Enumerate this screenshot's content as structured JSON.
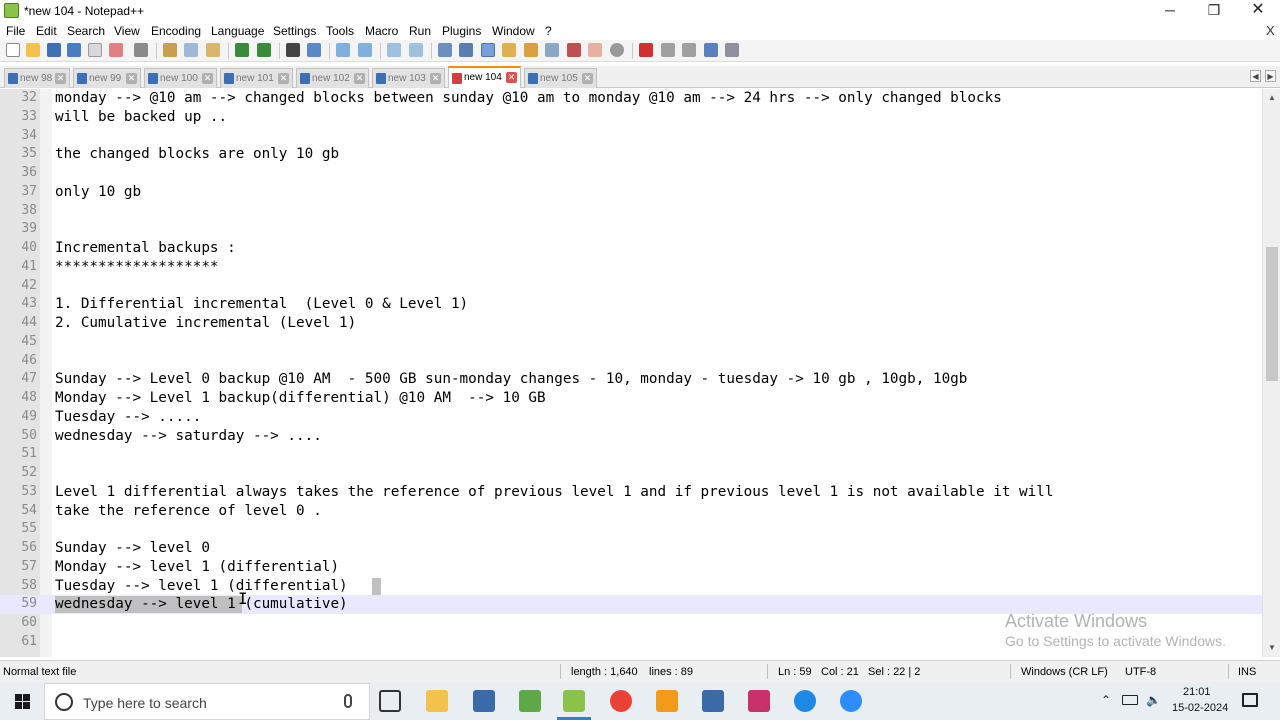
{
  "window": {
    "title": "*new 104 - Notepad++",
    "controls": {
      "minimize": "─",
      "maximize": "❐",
      "close": "✕"
    }
  },
  "menu": {
    "items": [
      "File",
      "Edit",
      "Search",
      "View",
      "Encoding",
      "Language",
      "Settings",
      "Tools",
      "Macro",
      "Run",
      "Plugins",
      "Window",
      "?"
    ],
    "close_glyph": "X"
  },
  "tabs": {
    "items": [
      "new 98",
      "new 99",
      "new 100",
      "new 101",
      "new 102",
      "new 103",
      "new 104",
      "new 105"
    ],
    "active": "new 104",
    "close_glyph": "✕",
    "scroll_left": "◀",
    "scroll_right": "▶"
  },
  "editor": {
    "lines": [
      {
        "n": "32",
        "text": "monday --> @10 am --> changed blocks between sunday @10 am to monday @10 am --> 24 hrs --> only changed blocks"
      },
      {
        "n": "33",
        "text": "will be backed up .."
      },
      {
        "n": "34",
        "text": ""
      },
      {
        "n": "35",
        "text": "the changed blocks are only 10 gb"
      },
      {
        "n": "36",
        "text": ""
      },
      {
        "n": "37",
        "text": "only 10 gb"
      },
      {
        "n": "38",
        "text": ""
      },
      {
        "n": "39",
        "text": ""
      },
      {
        "n": "40",
        "text": "Incremental backups :"
      },
      {
        "n": "41",
        "text": "*******************"
      },
      {
        "n": "42",
        "text": ""
      },
      {
        "n": "43",
        "text": "1. Differential incremental  (Level 0 & Level 1)"
      },
      {
        "n": "44",
        "text": "2. Cumulative incremental (Level 1)"
      },
      {
        "n": "45",
        "text": ""
      },
      {
        "n": "46",
        "text": ""
      },
      {
        "n": "47",
        "text": "Sunday --> Level 0 backup @10 AM  - 500 GB sun-monday changes - 10, monday - tuesday -> 10 gb , 10gb, 10gb"
      },
      {
        "n": "48",
        "text": "Monday --> Level 1 backup(differential) @10 AM  --> 10 GB"
      },
      {
        "n": "49",
        "text": "Tuesday --> ....."
      },
      {
        "n": "50",
        "text": "wednesday --> saturday --> ...."
      },
      {
        "n": "51",
        "text": ""
      },
      {
        "n": "52",
        "text": ""
      },
      {
        "n": "53",
        "text": "Level 1 differential always takes the reference of previous level 1 and if previous level 1 is not available it will"
      },
      {
        "n": "54",
        "text": "take the reference of level 0 ."
      },
      {
        "n": "55",
        "text": ""
      },
      {
        "n": "56",
        "text": "Sunday --> level 0"
      },
      {
        "n": "57",
        "text": "Monday --> level 1 (differential)"
      },
      {
        "n": "58",
        "text": "Tuesday --> level 1 (differential)"
      },
      {
        "n": "59",
        "text": "wednesday --> level 1 (cumulative)"
      },
      {
        "n": "60",
        "text": ""
      },
      {
        "n": "61",
        "text": ""
      }
    ],
    "current_line": "59",
    "scroll_up": "▲",
    "scroll_down": "▼",
    "cursor_glyph": "I"
  },
  "watermark": {
    "line1": "Activate Windows",
    "line2": "Go to Settings to activate Windows."
  },
  "status": {
    "file_type": "Normal text file",
    "length": "length : 1,640",
    "lines": "lines : 89",
    "ln": "Ln : 59",
    "col": "Col : 21",
    "sel": "Sel : 22 | 2",
    "eol": "Windows (CR LF)",
    "encoding": "UTF-8",
    "mode": "INS"
  },
  "taskbar": {
    "search_placeholder": "Type here to search",
    "time": "21:01",
    "date": "15-02-2024",
    "apps": [
      "task-view",
      "file-explorer",
      "network-tool",
      "file-transfer",
      "notepad-plus-plus",
      "chrome",
      "app-orange",
      "network-tool-2",
      "visual-studio-code",
      "webex",
      "zoom"
    ],
    "tray": [
      "chevron-up",
      "battery",
      "speaker"
    ]
  },
  "colors": {
    "active_tab_accent": "#fa8b0c",
    "current_line": "#e8e8ff",
    "selection": "#c0c0c0",
    "taskbar": "#e9eef3"
  }
}
